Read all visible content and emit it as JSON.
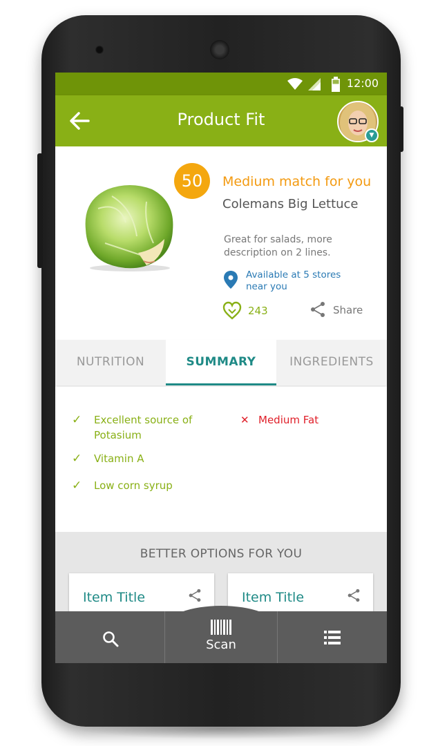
{
  "statusbar": {
    "time": "12:00"
  },
  "appbar": {
    "title": "Product Fit"
  },
  "product": {
    "score": "50",
    "match": "Medium match for you",
    "name": "Colemans Big Lettuce",
    "description": "Great for salads, more description on 2 lines.",
    "availability": "Available at 5 stores near you",
    "likes": "243",
    "share_label": "Share"
  },
  "tabs": [
    {
      "label": "NUTRITION",
      "active": false
    },
    {
      "label": "SUMMARY",
      "active": true
    },
    {
      "label": "INGREDIENTS",
      "active": false
    }
  ],
  "summary": {
    "positives": [
      "Excellent source of Potasium",
      "Vitamin A",
      "Low corn syrup"
    ],
    "negatives": [
      "Medium Fat"
    ]
  },
  "better_options": {
    "header": "BETTER OPTIONS FOR YOU",
    "cards": [
      {
        "title": "Item Title"
      },
      {
        "title": "Item Title"
      }
    ]
  },
  "bottom_nav": {
    "scan_label": "Scan"
  },
  "colors": {
    "brand_green": "#89b016",
    "status_green": "#6f9408",
    "accent_orange": "#f39a10",
    "teal": "#1f8a86",
    "negative_red": "#e0202a",
    "link_blue": "#2a7ab4"
  },
  "icons": [
    "back-arrow-icon",
    "wifi-icon",
    "signal-icon",
    "battery-icon",
    "map-pin-icon",
    "heart-icon",
    "share-icon",
    "check-icon",
    "cross-icon",
    "search-icon",
    "barcode-icon",
    "list-icon"
  ]
}
